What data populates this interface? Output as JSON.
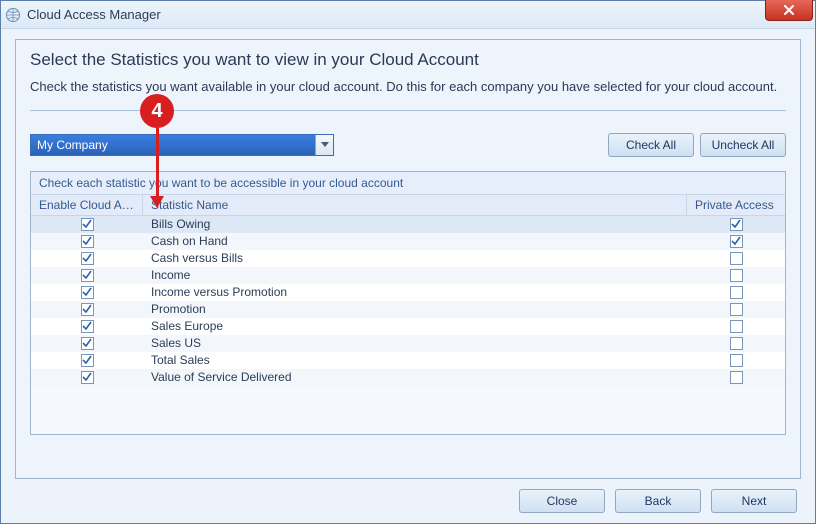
{
  "window": {
    "title": "Cloud Access Manager"
  },
  "heading": "Select the Statistics you want to view in your Cloud Account",
  "subtext": "Check the statistics you want available in your cloud account. Do this for each company you have selected for your cloud account.",
  "company_select": {
    "value": "My Company"
  },
  "buttons": {
    "check_all": "Check All",
    "uncheck_all": "Uncheck All",
    "close": "Close",
    "back": "Back",
    "next": "Next"
  },
  "grid": {
    "caption": "Check each statistic you want to be accessible in your cloud account",
    "columns": {
      "enable": "Enable Cloud Acc...",
      "name": "Statistic Name",
      "private": "Private Access"
    },
    "rows": [
      {
        "enable": true,
        "name": "Bills Owing",
        "private": true,
        "selected": true
      },
      {
        "enable": true,
        "name": "Cash on Hand",
        "private": true
      },
      {
        "enable": true,
        "name": "Cash versus Bills",
        "private": false
      },
      {
        "enable": true,
        "name": "Income",
        "private": false
      },
      {
        "enable": true,
        "name": "Income versus Promotion",
        "private": false
      },
      {
        "enable": true,
        "name": "Promotion",
        "private": false
      },
      {
        "enable": true,
        "name": "Sales Europe",
        "private": false
      },
      {
        "enable": true,
        "name": "Sales US",
        "private": false
      },
      {
        "enable": true,
        "name": "Total Sales",
        "private": false
      },
      {
        "enable": true,
        "name": "Value of Service Delivered",
        "private": false
      }
    ]
  },
  "callout": {
    "number": "4"
  }
}
